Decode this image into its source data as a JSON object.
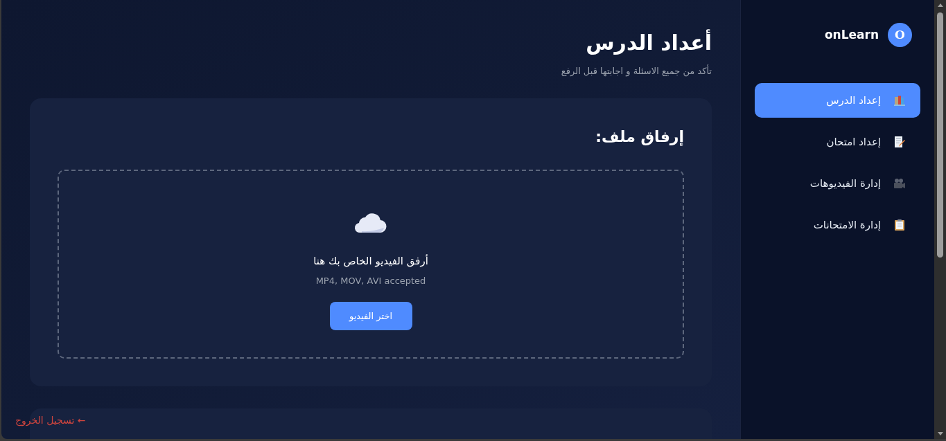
{
  "header": {
    "title": "أعداد الدرس",
    "subtitle": "تأكد من جميع الاسئلة و اجابتها قبل الرفع"
  },
  "upload_card": {
    "title": "إرفاق ملف:",
    "dropzone": {
      "prompt": "أرفق الفيديو الخاص بك هنا",
      "hint": "MP4, MOV, AVI accepted",
      "button": "اختر الفيديو"
    }
  },
  "sidebar": {
    "brand": {
      "name": "onLearn",
      "avatar_letter": "O"
    },
    "items": [
      {
        "label": "إعداد الدرس",
        "selected": true
      },
      {
        "label": "إعداد امتحان",
        "selected": false
      },
      {
        "label": "إدارة الفيديوهات",
        "selected": false
      },
      {
        "label": "إدارة الامتحانات",
        "selected": false
      }
    ],
    "logout": "← تسجيل الخروج"
  }
}
